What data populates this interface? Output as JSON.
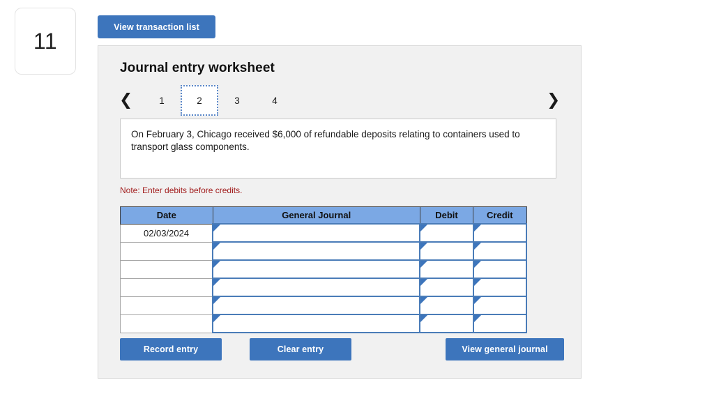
{
  "question": {
    "number": "11"
  },
  "toolbar": {
    "view_transaction_list_label": "View transaction list"
  },
  "panel": {
    "title": "Journal entry worksheet",
    "pager": {
      "prev_icon": "chevron-left-icon",
      "next_icon": "chevron-right-icon",
      "tabs": [
        {
          "label": "1",
          "active": false
        },
        {
          "label": "2",
          "active": true
        },
        {
          "label": "3",
          "active": false
        },
        {
          "label": "4",
          "active": false
        }
      ]
    },
    "description": "On February 3, Chicago received $6,000 of refundable deposits relating to containers used to transport glass components.",
    "note": "Note: Enter debits before credits.",
    "table": {
      "headers": [
        "Date",
        "General Journal",
        "Debit",
        "Credit"
      ],
      "rows": [
        {
          "date": "02/03/2024",
          "general_journal": "",
          "debit": "",
          "credit": ""
        },
        {
          "date": "",
          "general_journal": "",
          "debit": "",
          "credit": ""
        },
        {
          "date": "",
          "general_journal": "",
          "debit": "",
          "credit": ""
        },
        {
          "date": "",
          "general_journal": "",
          "debit": "",
          "credit": ""
        },
        {
          "date": "",
          "general_journal": "",
          "debit": "",
          "credit": ""
        },
        {
          "date": "",
          "general_journal": "",
          "debit": "",
          "credit": ""
        }
      ]
    },
    "actions": {
      "record_label": "Record entry",
      "clear_label": "Clear entry",
      "view_journal_label": "View general journal"
    }
  },
  "colors": {
    "button_blue": "#3d75bc",
    "header_blue": "#7ba8e4",
    "input_border_blue": "#4a7cb8",
    "note_red": "#a32020",
    "panel_bg": "#f1f1f1"
  }
}
